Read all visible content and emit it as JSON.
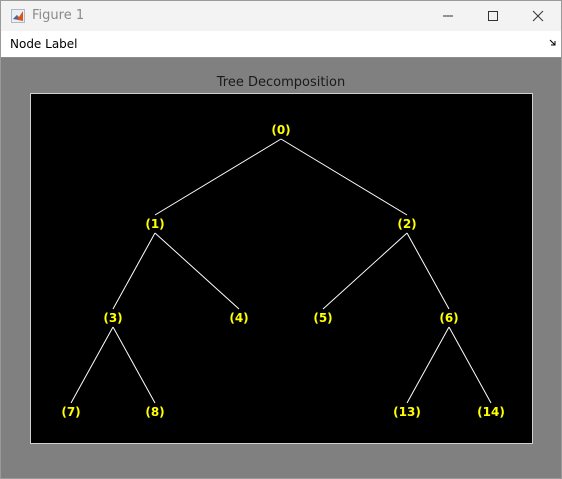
{
  "window": {
    "title": "Figure 1"
  },
  "toolbar": {
    "node_label": "Node Label",
    "dropdown_icon": "chevron-down-icon"
  },
  "plot": {
    "title": "Tree Decomposition",
    "background": "#000000",
    "edge_color": "#ffffff",
    "label_color": "#ffff00",
    "nodes": [
      {
        "id": "0",
        "label": "(0)"
      },
      {
        "id": "1",
        "label": "(1)"
      },
      {
        "id": "2",
        "label": "(2)"
      },
      {
        "id": "3",
        "label": "(3)"
      },
      {
        "id": "4",
        "label": "(4)"
      },
      {
        "id": "5",
        "label": "(5)"
      },
      {
        "id": "6",
        "label": "(6)"
      },
      {
        "id": "7",
        "label": "(7)"
      },
      {
        "id": "8",
        "label": "(8)"
      },
      {
        "id": "13",
        "label": "(13)"
      },
      {
        "id": "14",
        "label": "(14)"
      }
    ],
    "edges": [
      [
        "0",
        "1"
      ],
      [
        "0",
        "2"
      ],
      [
        "1",
        "3"
      ],
      [
        "1",
        "4"
      ],
      [
        "2",
        "5"
      ],
      [
        "2",
        "6"
      ],
      [
        "3",
        "7"
      ],
      [
        "3",
        "8"
      ],
      [
        "6",
        "13"
      ],
      [
        "6",
        "14"
      ]
    ]
  }
}
